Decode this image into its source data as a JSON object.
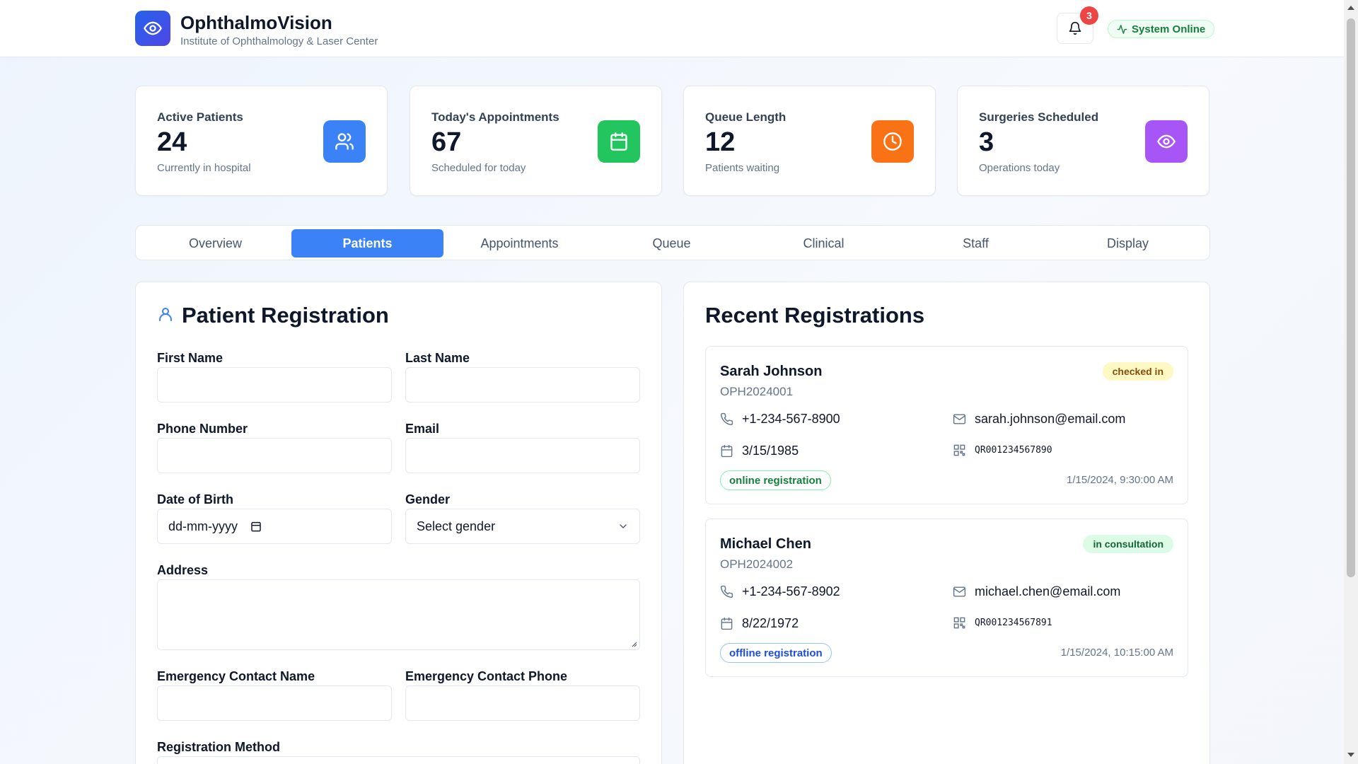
{
  "header": {
    "title": "OphthalmoVision",
    "subtitle": "Institute of Ophthalmology & Laser Center",
    "notification_count": "3",
    "status_label": "System Online"
  },
  "stats": [
    {
      "label": "Active Patients",
      "value": "24",
      "sub": "Currently in hospital",
      "icon": "users-icon",
      "color": "#3b82f6"
    },
    {
      "label": "Today's Appointments",
      "value": "67",
      "sub": "Scheduled for today",
      "icon": "calendar-icon",
      "color": "#22c55e"
    },
    {
      "label": "Queue Length",
      "value": "12",
      "sub": "Patients waiting",
      "icon": "clock-icon",
      "color": "#f97316"
    },
    {
      "label": "Surgeries Scheduled",
      "value": "3",
      "sub": "Operations today",
      "icon": "eye-icon",
      "color": "#a855f7"
    }
  ],
  "tabs": [
    "Overview",
    "Patients",
    "Appointments",
    "Queue",
    "Clinical",
    "Staff",
    "Display"
  ],
  "active_tab": "Patients",
  "registration": {
    "title": "Patient Registration",
    "first_name_label": "First Name",
    "last_name_label": "Last Name",
    "phone_label": "Phone Number",
    "email_label": "Email",
    "dob_label": "Date of Birth",
    "dob_placeholder": "dd-mm-yyyy",
    "gender_label": "Gender",
    "gender_value": "Select gender",
    "address_label": "Address",
    "emergency_name_label": "Emergency Contact Name",
    "emergency_phone_label": "Emergency Contact Phone",
    "method_label": "Registration Method"
  },
  "recent": {
    "title": "Recent Registrations",
    "items": [
      {
        "name": "Sarah Johnson",
        "id": "OPH2024001",
        "status": "checked in",
        "phone": "+1-234-567-8900",
        "email": "sarah.johnson@email.com",
        "dob": "3/15/1985",
        "qr": "QR001234567890",
        "method": "online registration",
        "timestamp": "1/15/2024, 9:30:00 AM"
      },
      {
        "name": "Michael Chen",
        "id": "OPH2024002",
        "status": "in consultation",
        "phone": "+1-234-567-8902",
        "email": "michael.chen@email.com",
        "dob": "8/22/1972",
        "qr": "QR001234567891",
        "method": "offline registration",
        "timestamp": "1/15/2024, 10:15:00 AM"
      }
    ]
  },
  "colors": {
    "accent": "#3b82f6",
    "success": "#15803d",
    "danger": "#ef4444"
  }
}
